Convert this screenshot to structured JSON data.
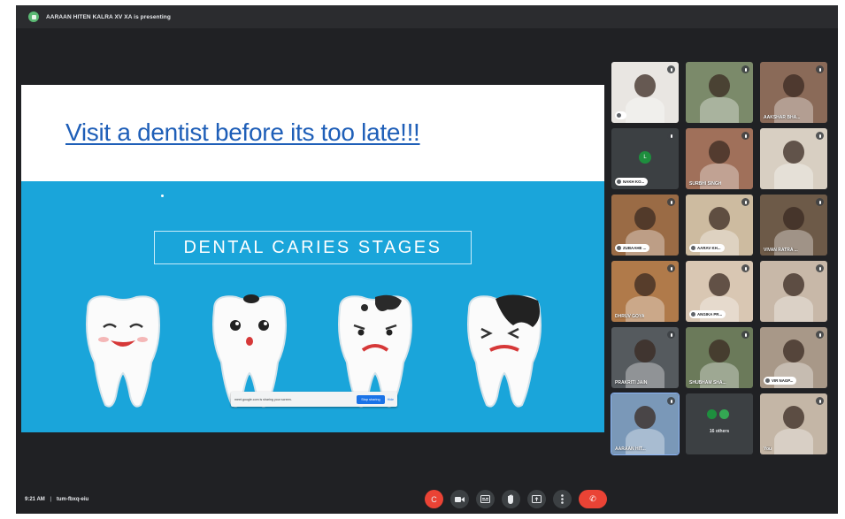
{
  "topbar": {
    "presenting_text": "AARAAN HITEN KALRA XV XA is presenting"
  },
  "slide": {
    "title": "Visit a dentist before its too late!!!",
    "banner": "DENTAL CARIES STAGES",
    "share_notice": {
      "text": "meet.google.com is sharing your screen.",
      "stop_label": "Stop sharing",
      "hide_label": "Hide"
    }
  },
  "participants": [
    {
      "name": "",
      "style": "pill",
      "bg": "#e9e6e2"
    },
    {
      "name": "",
      "style": "plain",
      "bg": "#7b8a6a"
    },
    {
      "name": "AAKSHAR BHA...",
      "style": "plain",
      "bg": "#8a6a58"
    },
    {
      "name": "NAKH KO...",
      "style": "pill",
      "bg": "#3c4043",
      "avatar": "L",
      "avatar_color": "#1e8e3e"
    },
    {
      "name": "SURBHI SINGH",
      "style": "plain",
      "bg": "#a0705a"
    },
    {
      "name": "",
      "style": "plain",
      "bg": "#d8cfc2"
    },
    {
      "name": "ZUBAAHE ...",
      "style": "pill",
      "bg": "#9a6b45"
    },
    {
      "name": "AARAV KH...",
      "style": "pill",
      "bg": "#cdbba0"
    },
    {
      "name": "VIVAN RATRA ...",
      "style": "plain",
      "bg": "#6d5a48"
    },
    {
      "name": "DHRUV GOYA",
      "style": "plain",
      "bg": "#b07a4a"
    },
    {
      "name": "ANGIKA PR...",
      "style": "pill",
      "bg": "#d9c7b3"
    },
    {
      "name": "",
      "style": "plain",
      "bg": "#c8b8a8"
    },
    {
      "name": "PRAKRITI JAIN",
      "style": "plain",
      "bg": "#555a5e"
    },
    {
      "name": "SHUBHAM SHA...",
      "style": "plain",
      "bg": "#6b7a5a"
    },
    {
      "name": "VIR NAGP...",
      "style": "pill",
      "bg": "#a89888"
    },
    {
      "name": "AARAAN HIT...",
      "style": "plain",
      "bg": "#7a98b8",
      "self": true
    },
    {
      "name": "16 others",
      "style": "others",
      "bg": "#3c4043"
    },
    {
      "name": "You",
      "style": "plain",
      "bg": "#c4b6a6"
    }
  ],
  "bottombar": {
    "time": "9:21 AM",
    "separator": "|",
    "meeting_code": "tum-fbxq-eiu"
  },
  "controls": {
    "captions_label": "C",
    "end_call_label": "✆"
  }
}
